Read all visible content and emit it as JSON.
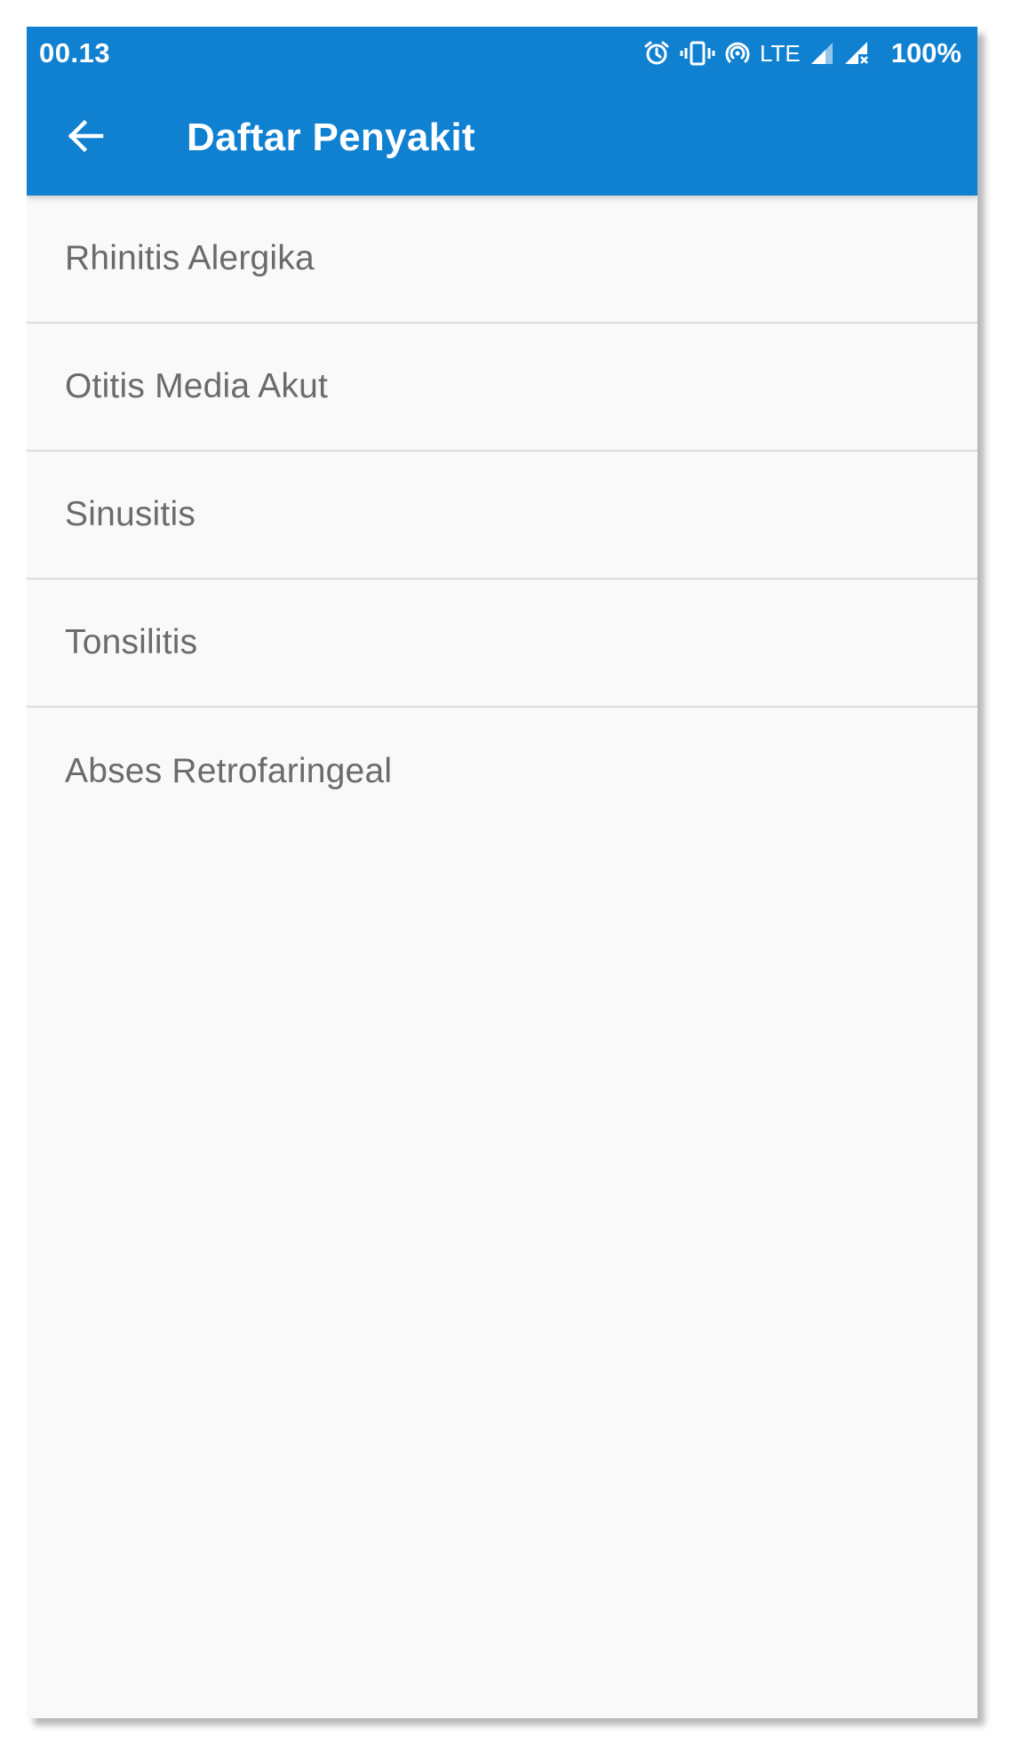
{
  "status_bar": {
    "time": "00.13",
    "network": "LTE",
    "battery": "100%",
    "icons": [
      "alarm-icon",
      "vibrate-icon",
      "hotspot-icon",
      "signal-icon",
      "signal-no-sim-icon"
    ]
  },
  "toolbar": {
    "back_icon": "arrow-back-icon",
    "title": "Daftar Penyakit"
  },
  "diseases": [
    {
      "label": "Rhinitis Alergika"
    },
    {
      "label": "Otitis Media Akut"
    },
    {
      "label": "Sinusitis"
    },
    {
      "label": "Tonsilitis"
    },
    {
      "label": "Abses Retrofaringeal"
    }
  ],
  "colors": {
    "app_bar": "#1081d1",
    "background": "#f9f9f9",
    "list_text": "#6b6b6b",
    "divider": "#dcdcdc"
  }
}
